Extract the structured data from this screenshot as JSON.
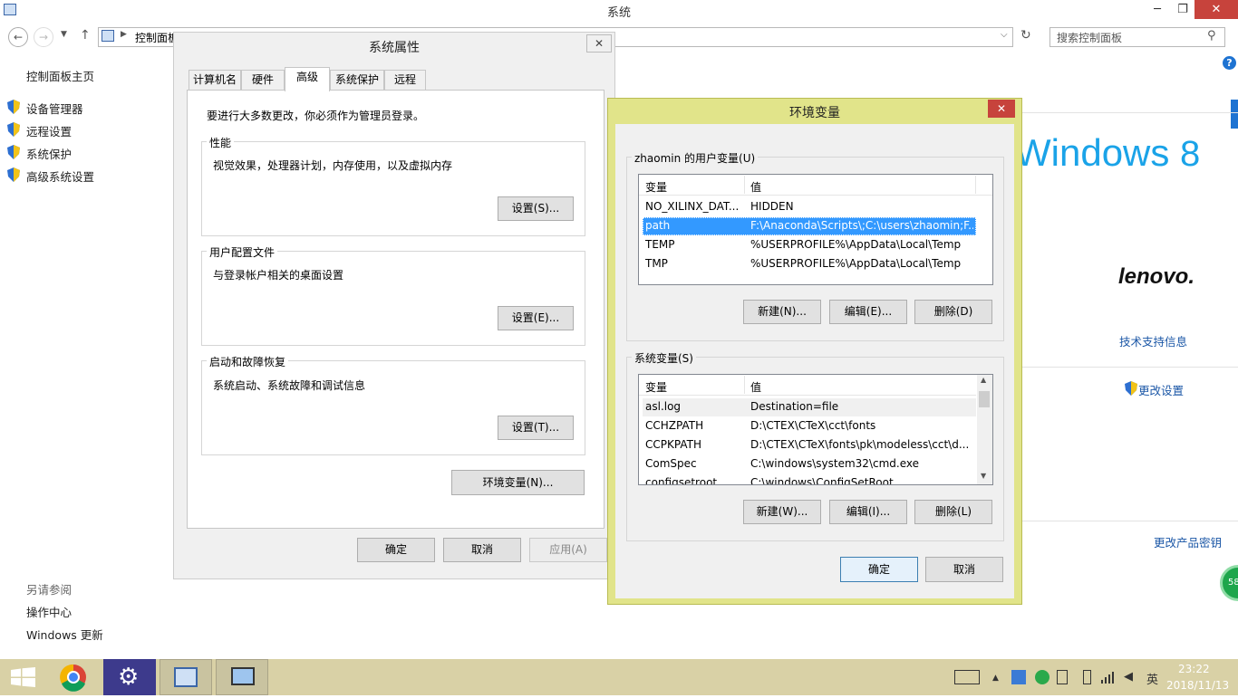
{
  "window": {
    "title": "系统",
    "min": "─",
    "max": "❐",
    "close": "✕"
  },
  "address": {
    "path": "控制面板",
    "search_placeholder": "搜索控制面板"
  },
  "left_panel": {
    "home": "控制面板主页",
    "links": [
      "设备管理器",
      "远程设置",
      "系统保护",
      "高级系统设置"
    ],
    "see_also_title": "另请参阅",
    "see_also": [
      "操作中心",
      "Windows 更新"
    ]
  },
  "right_panel": {
    "windows_logo": "Windows",
    "windows_ver": "8",
    "lenovo": "lenovo.",
    "support": "技术支持信息",
    "change_settings": "更改设置",
    "change_key": "更改产品密钥",
    "badge": "58"
  },
  "sysprops": {
    "title": "系统属性",
    "close": "✕",
    "tabs": [
      "计算机名",
      "硬件",
      "高级",
      "系统保护",
      "远程"
    ],
    "admin_note": "要进行大多数更改，你必须作为管理员登录。",
    "perf_label": "性能",
    "perf_desc": "视觉效果，处理器计划，内存使用，以及虚拟内存",
    "perf_btn": "设置(S)...",
    "profile_label": "用户配置文件",
    "profile_desc": "与登录帐户相关的桌面设置",
    "profile_btn": "设置(E)...",
    "startup_label": "启动和故障恢复",
    "startup_desc": "系统启动、系统故障和调试信息",
    "startup_btn": "设置(T)...",
    "env_btn": "环境变量(N)...",
    "ok": "确定",
    "cancel": "取消",
    "apply": "应用(A)"
  },
  "env": {
    "title": "环境变量",
    "close": "✕",
    "user_label": "zhaomin 的用户变量(U)",
    "col_var": "变量",
    "col_val": "值",
    "user_vars": [
      {
        "name": "NO_XILINX_DAT...",
        "value": "HIDDEN"
      },
      {
        "name": "path",
        "value": "F:\\Anaconda\\Scripts\\;C:\\users\\zhaomin;F..."
      },
      {
        "name": "TEMP",
        "value": "%USERPROFILE%\\AppData\\Local\\Temp"
      },
      {
        "name": "TMP",
        "value": "%USERPROFILE%\\AppData\\Local\\Temp"
      }
    ],
    "user_new": "新建(N)...",
    "user_edit": "编辑(E)...",
    "user_delete": "删除(D)",
    "sys_label": "系统变量(S)",
    "sys_vars": [
      {
        "name": "asl.log",
        "value": "Destination=file"
      },
      {
        "name": "CCHZPATH",
        "value": "D:\\CTEX\\CTeX\\cct\\fonts"
      },
      {
        "name": "CCPKPATH",
        "value": "D:\\CTEX\\CTeX\\fonts\\pk\\modeless\\cct\\d..."
      },
      {
        "name": "ComSpec",
        "value": "C:\\windows\\system32\\cmd.exe"
      },
      {
        "name": "configsetroot",
        "value": "C:\\windows\\ConfigSetRoot"
      }
    ],
    "sys_new": "新建(W)...",
    "sys_edit": "编辑(I)...",
    "sys_delete": "删除(L)",
    "ok": "确定",
    "cancel": "取消"
  },
  "taskbar": {
    "ime": "英",
    "time": "23:22",
    "date": "2018/11/13"
  }
}
